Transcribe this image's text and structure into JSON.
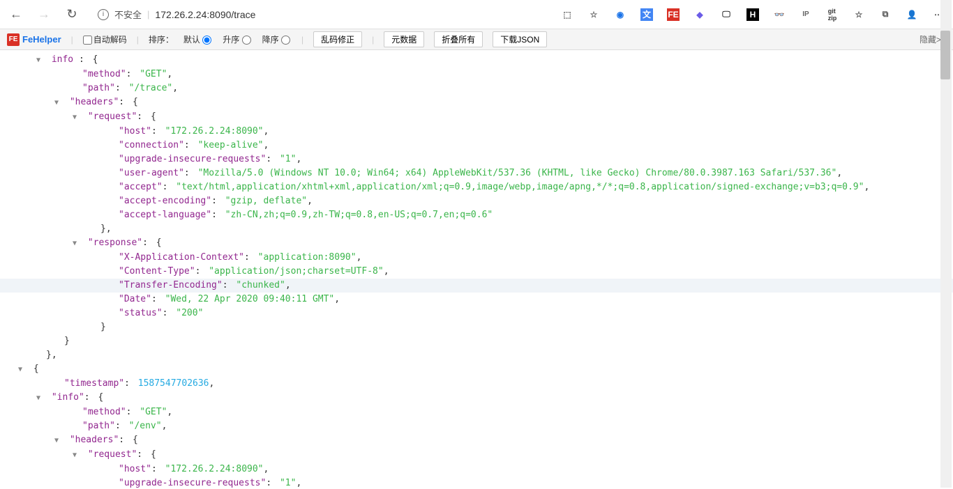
{
  "browser": {
    "insecure_label": "不安全",
    "url": "172.26.2.24:8090/trace"
  },
  "fehelper": {
    "name": "FeHelper",
    "auto_decode": "自动解码",
    "sort_label": "排序：",
    "sort_default": "默认",
    "sort_asc": "升序",
    "sort_desc": "降序",
    "btn_fix": "乱码修正",
    "btn_meta": "元数据",
    "btn_collapse": "折叠所有",
    "btn_download": "下载JSON",
    "hide": "隐藏>>"
  },
  "json": {
    "info_label": "info",
    "method_k": "method",
    "method_v1": "GET",
    "path_k": "path",
    "path_v1": "/trace",
    "headers_k": "headers",
    "request_k": "request",
    "host_k": "host",
    "host_v": "172.26.2.24:8090",
    "connection_k": "connection",
    "connection_v": "keep-alive",
    "uir_k": "upgrade-insecure-requests",
    "uir_v": "1",
    "ua_k": "user-agent",
    "ua_v": "Mozilla/5.0 (Windows NT 10.0; Win64; x64) AppleWebKit/537.36 (KHTML, like Gecko) Chrome/80.0.3987.163 Safari/537.36",
    "accept_k": "accept",
    "accept_v": "text/html,application/xhtml+xml,application/xml;q=0.9,image/webp,image/apng,*/*;q=0.8,application/signed-exchange;v=b3;q=0.9",
    "ae_k": "accept-encoding",
    "ae_v": "gzip, deflate",
    "al_k": "accept-language",
    "al_v": "zh-CN,zh;q=0.9,zh-TW;q=0.8,en-US;q=0.7,en;q=0.6",
    "response_k": "response",
    "xac_k": "X-Application-Context",
    "xac_v": "application:8090",
    "ct_k": "Content-Type",
    "ct_v": "application/json;charset=UTF-8",
    "te_k": "Transfer-Encoding",
    "te_v": "chunked",
    "date_k": "Date",
    "date_v": "Wed, 22 Apr 2020 09:40:11 GMT",
    "status_k": "status",
    "status_v": "200",
    "timestamp_k": "timestamp",
    "timestamp_v": "1587547702636",
    "path_v2": "/env"
  }
}
